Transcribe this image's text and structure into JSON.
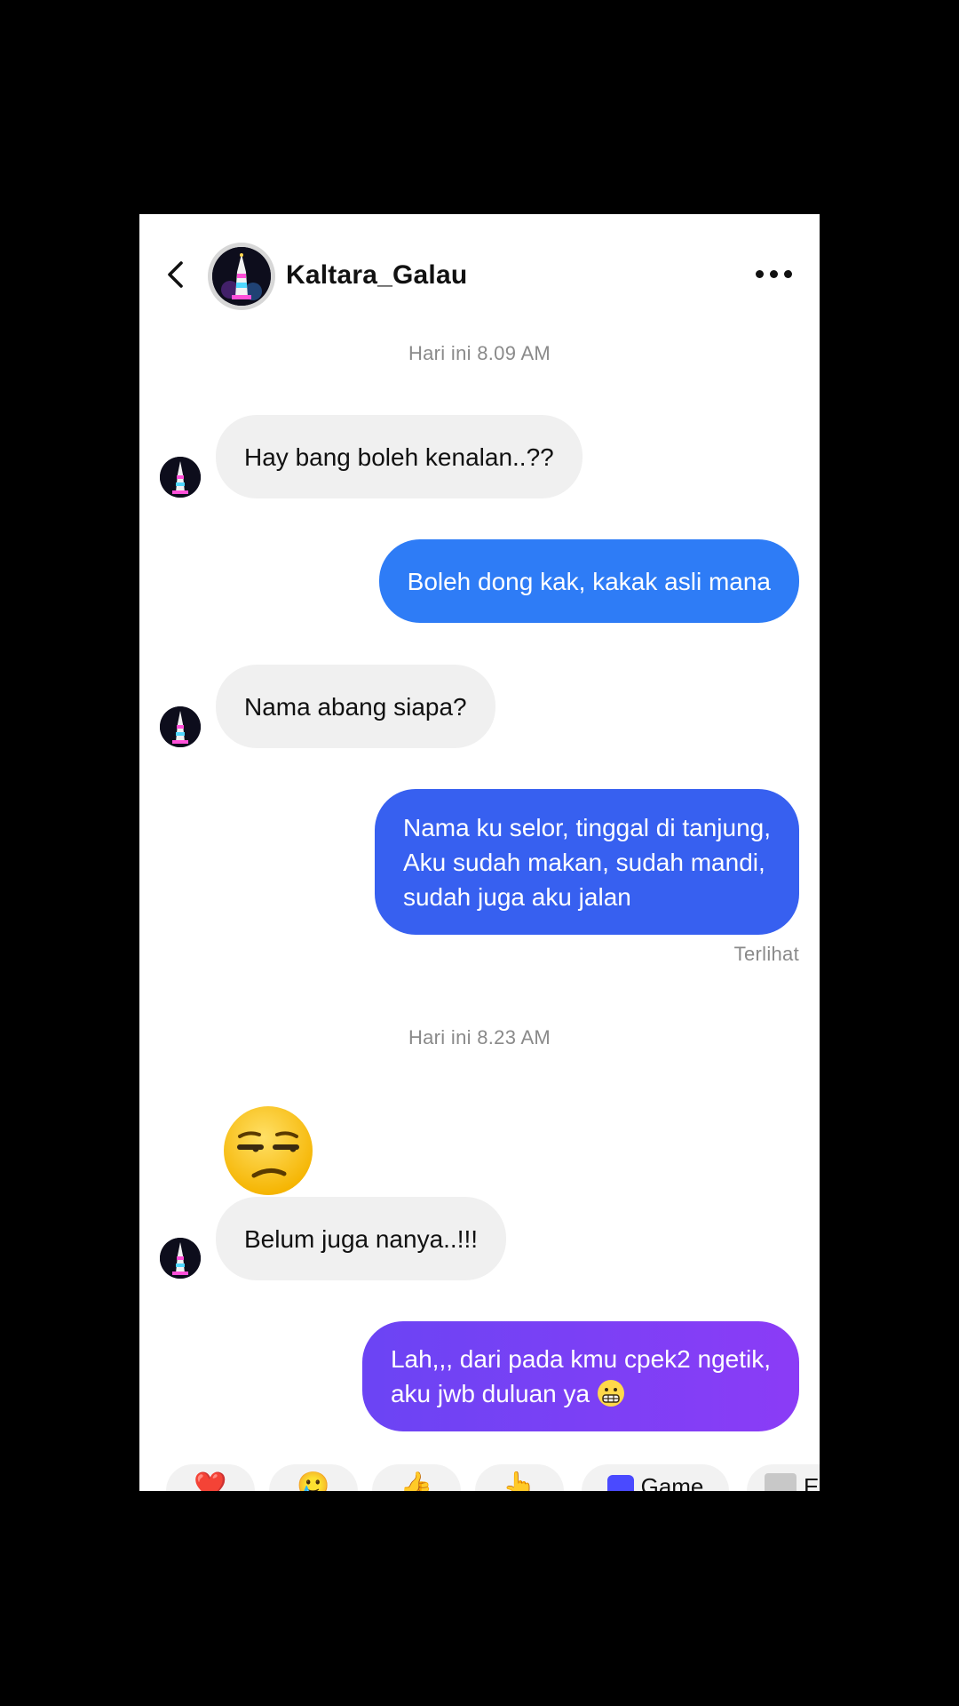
{
  "header": {
    "username": "Kaltara_Galau",
    "icons": {
      "back": "chevron-left-icon",
      "more": "more-horizontal-icon"
    }
  },
  "conversation": {
    "groups": [
      {
        "timestamp": "Hari ini 8.09 AM",
        "messages": [
          {
            "from": "them",
            "text": "Hay bang boleh kenalan..??"
          },
          {
            "from": "me",
            "text": "Boleh dong kak, kakak asli mana"
          },
          {
            "from": "them",
            "text": "Nama abang siapa?"
          },
          {
            "from": "me",
            "text": "Nama ku selor, tinggal di tanjung,\nAku sudah makan, sudah mandi,\nsudah juga aku jalan"
          }
        ],
        "status": "Terlihat"
      },
      {
        "timestamp": "Hari ini 8.23 AM",
        "messages": [
          {
            "from": "them",
            "type": "emoji",
            "emoji": "😒"
          },
          {
            "from": "them",
            "text": "Belum juga nanya..!!!"
          },
          {
            "from": "me",
            "text": "Lah,,, dari pada kmu cpek2 ngetik,\naku jwb duluan ya",
            "emoji": "😬"
          }
        ]
      }
    ]
  },
  "quick_replies": [
    {
      "glyph": "❤️"
    },
    {
      "glyph": "🥲"
    },
    {
      "glyph": "👍"
    },
    {
      "glyph": "👆"
    },
    {
      "icon": "game-icon",
      "label": "Game"
    },
    {
      "icon": "thumbnail-image",
      "label": "E"
    }
  ],
  "colors": {
    "incoming_bubble": "#f0f0f0",
    "outgoing_bubble_1": "#2e7cf6",
    "outgoing_bubble_2": "#3760f0",
    "outgoing_bubble_3": "#7f3cf6",
    "timestamp_text": "#8a8a8a"
  }
}
